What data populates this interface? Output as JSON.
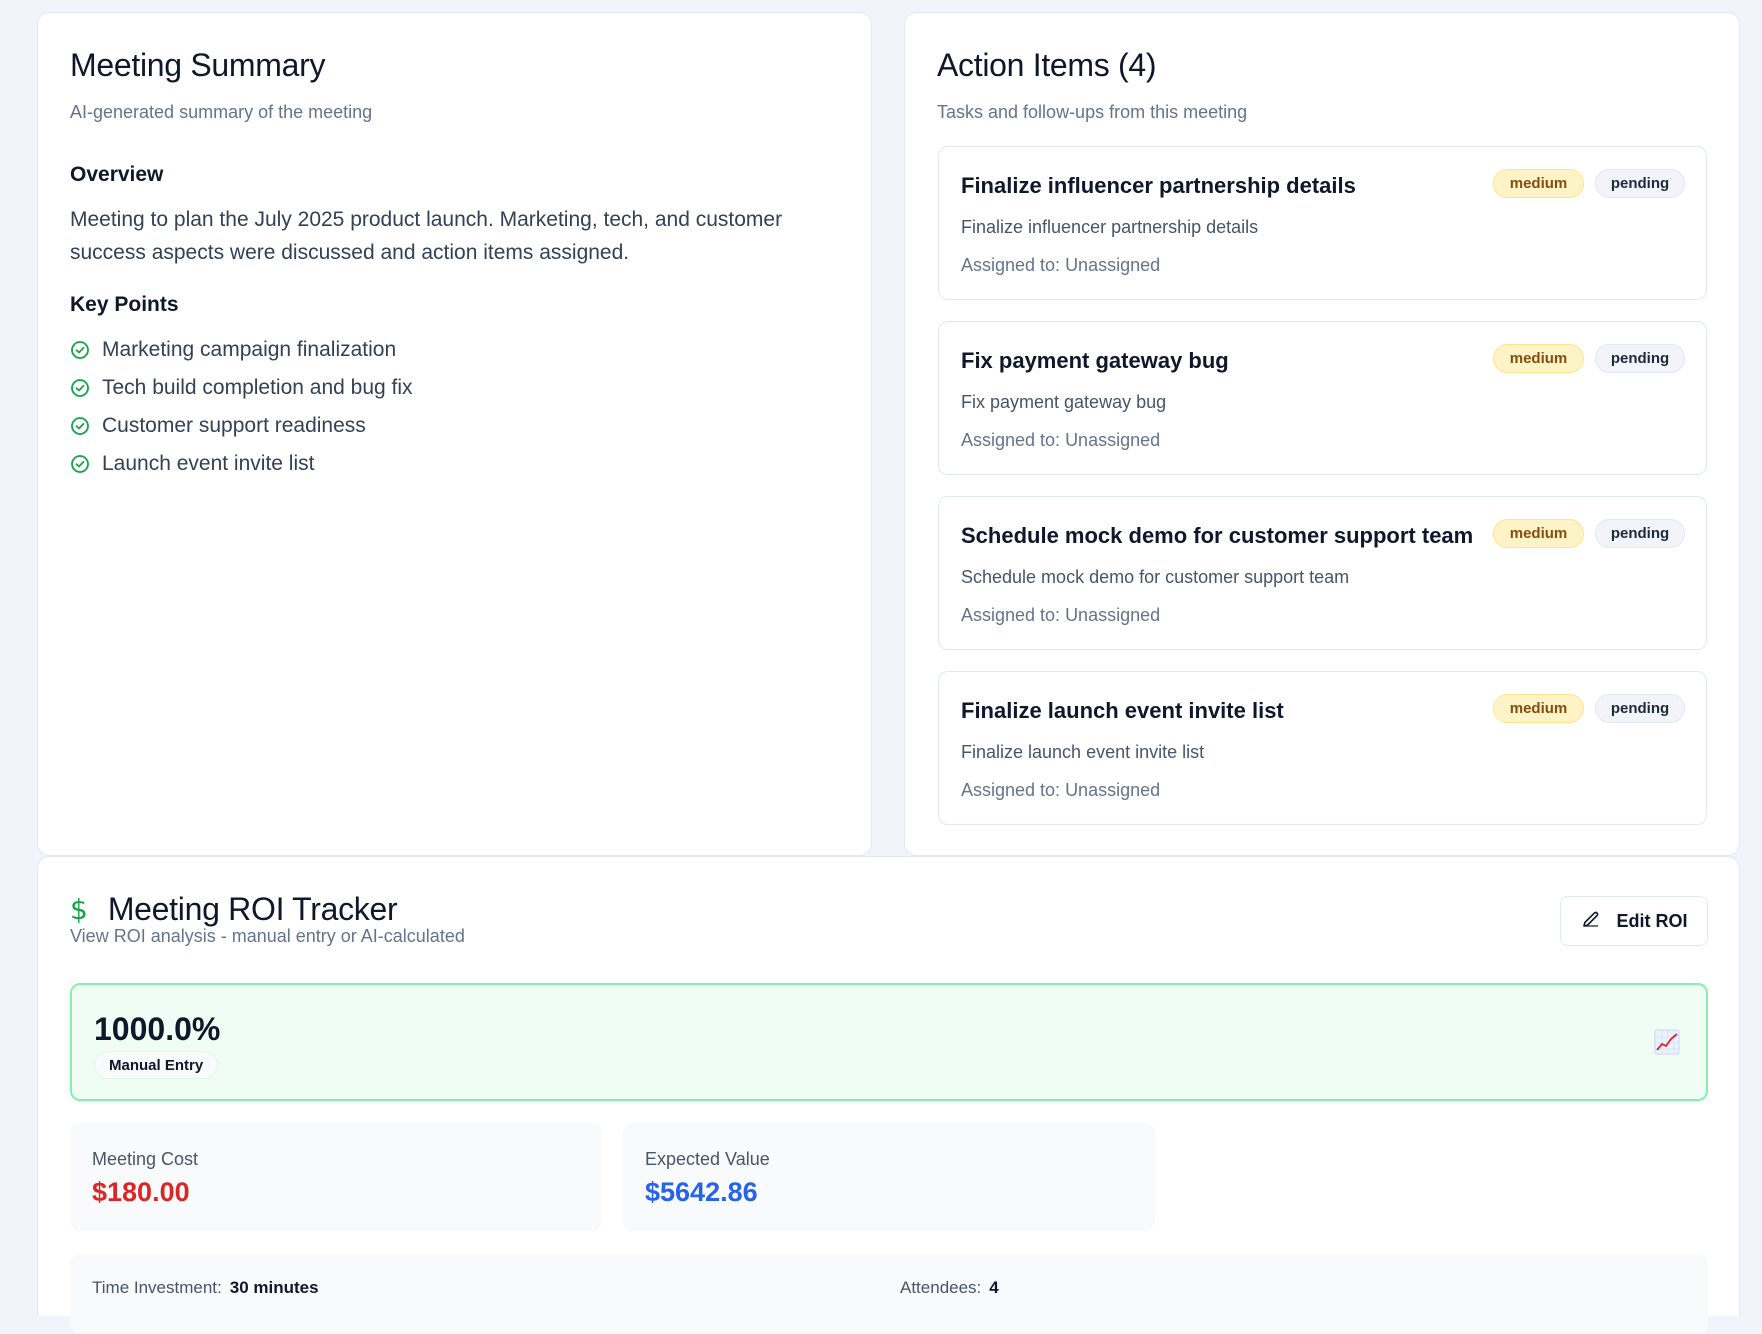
{
  "summary": {
    "title": "Meeting Summary",
    "subtitle": "AI-generated summary of the meeting",
    "overview_heading": "Overview",
    "overview_text": "Meeting to plan the July 2025 product launch. Marketing, tech, and customer success aspects were discussed and action items assigned.",
    "key_points_heading": "Key Points",
    "key_points": [
      "Marketing campaign finalization",
      "Tech build completion and bug fix",
      "Customer support readiness",
      "Launch event invite list"
    ]
  },
  "actions": {
    "title": "Action Items (4)",
    "subtitle": "Tasks and follow-ups from this meeting",
    "items": [
      {
        "title": "Finalize influencer partnership details",
        "description": "Finalize influencer partnership details",
        "assigned": "Assigned to: Unassigned",
        "priority": "medium",
        "status": "pending"
      },
      {
        "title": "Fix payment gateway bug",
        "description": "Fix payment gateway bug",
        "assigned": "Assigned to: Unassigned",
        "priority": "medium",
        "status": "pending"
      },
      {
        "title": "Schedule mock demo for customer support team",
        "description": "Schedule mock demo for customer support team",
        "assigned": "Assigned to: Unassigned",
        "priority": "medium",
        "status": "pending"
      },
      {
        "title": "Finalize launch event invite list",
        "description": "Finalize launch event invite list",
        "assigned": "Assigned to: Unassigned",
        "priority": "medium",
        "status": "pending"
      }
    ]
  },
  "roi": {
    "icon": "dollar-icon",
    "title": "Meeting ROI Tracker",
    "subtitle": "View ROI analysis - manual entry or AI-calculated",
    "edit_label": "Edit ROI",
    "value": "1000.0%",
    "source": "Manual Entry",
    "meeting_cost_label": "Meeting Cost",
    "meeting_cost": "$180.00",
    "expected_value_label": "Expected Value",
    "expected_value": "$5642.86",
    "time_label": "Time Investment:",
    "time_value": "30 minutes",
    "attendees_label": "Attendees:",
    "attendees_value": "4"
  },
  "colors": {
    "background": "#f1f5fb",
    "success": "#16a34a",
    "cost": "#dc2626",
    "value": "#2563eb",
    "priority_medium_bg": "#fef3c7"
  }
}
